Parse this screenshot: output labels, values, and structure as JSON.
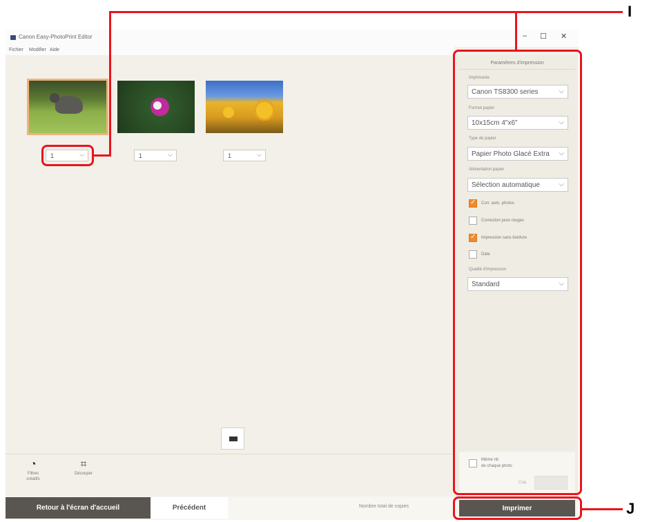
{
  "window": {
    "title": "Canon Easy-PhotoPrint Editor",
    "controls": {
      "minimize": "–",
      "maximize": "☐",
      "close": "✕"
    }
  },
  "menu": [
    "Fichier",
    "Modifier",
    "Aide"
  ],
  "photos": [
    {
      "quantity": "1",
      "selected": true
    },
    {
      "quantity": "1",
      "selected": false
    },
    {
      "quantity": "1",
      "selected": false
    }
  ],
  "toolbar": {
    "filters_label": "Filtres créatifs",
    "crop_label": "Découper"
  },
  "print_settings": {
    "header": "Paramètres d'impression",
    "printer_label": "Imprimante",
    "printer_value": "Canon TS8300 series",
    "paper_size_label": "Format papier",
    "paper_size_value": "10x15cm 4\"x6\"",
    "media_type_label": "Type de papier",
    "media_type_value": "Papier Photo Glacé Extra",
    "paper_source_label": "Alimentation papier",
    "paper_source_value": "Sélection automatique",
    "checkboxes": [
      {
        "label": "Corr. auto. photos",
        "checked": true
      },
      {
        "label": "Correction yeux rouges",
        "checked": false
      },
      {
        "label": "Impression sans bordure",
        "checked": true
      },
      {
        "label": "Date",
        "checked": false
      }
    ],
    "quality_label": "Qualité d'impression",
    "quality_value": "Standard",
    "same_copies_line1": "Même nb",
    "same_copies_line2": "de chaque photo",
    "copies_label": "Cop.",
    "copies_value": ""
  },
  "bottom": {
    "home_button": "Retour à l'écran d'accueil",
    "back_button": "Précédent",
    "total_copies_label": "Nombre total de copies",
    "print_button": "Imprimer"
  },
  "callouts": {
    "top": "I",
    "bottom": "J"
  },
  "colors": {
    "annotation_red": "#e8141c",
    "accent_orange": "#f08a2a",
    "button_dark": "#595551"
  }
}
